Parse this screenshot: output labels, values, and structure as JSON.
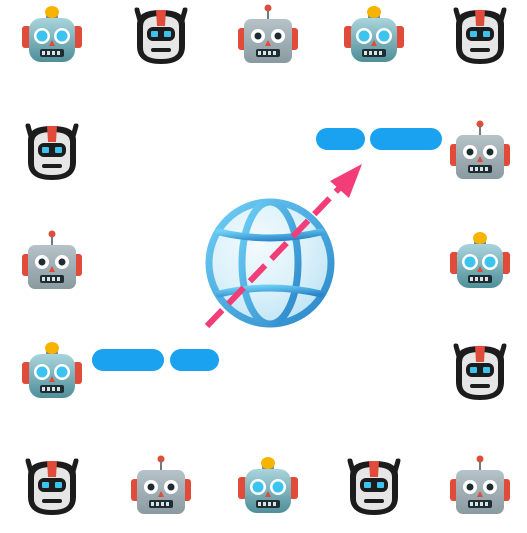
{
  "scene": {
    "robot_icon": "robot-face-icon",
    "globe_icon": "globe-with-meridians-icon",
    "arrow_icon": "dashed-arrow-icon",
    "colors": {
      "pill": "#1aa2f0",
      "arrow": "#f23d78",
      "background": "#ffffff"
    },
    "robots": [
      {
        "variant": "blue-antenna-bulb"
      },
      {
        "variant": "black-helmet"
      },
      {
        "variant": "grey-antenna"
      },
      {
        "variant": "blue-antenna-bulb"
      },
      {
        "variant": "black-helmet"
      },
      {
        "variant": "black-helmet"
      },
      {
        "variant": "grey-antenna"
      },
      {
        "variant": "grey-antenna"
      },
      {
        "variant": "blue-antenna-bulb"
      },
      {
        "variant": "blue-antenna-bulb"
      },
      {
        "variant": "black-helmet"
      },
      {
        "variant": "black-helmet"
      },
      {
        "variant": "grey-antenna"
      },
      {
        "variant": "blue-antenna-bulb"
      },
      {
        "variant": "black-helmet"
      },
      {
        "variant": "grey-antenna"
      }
    ]
  }
}
